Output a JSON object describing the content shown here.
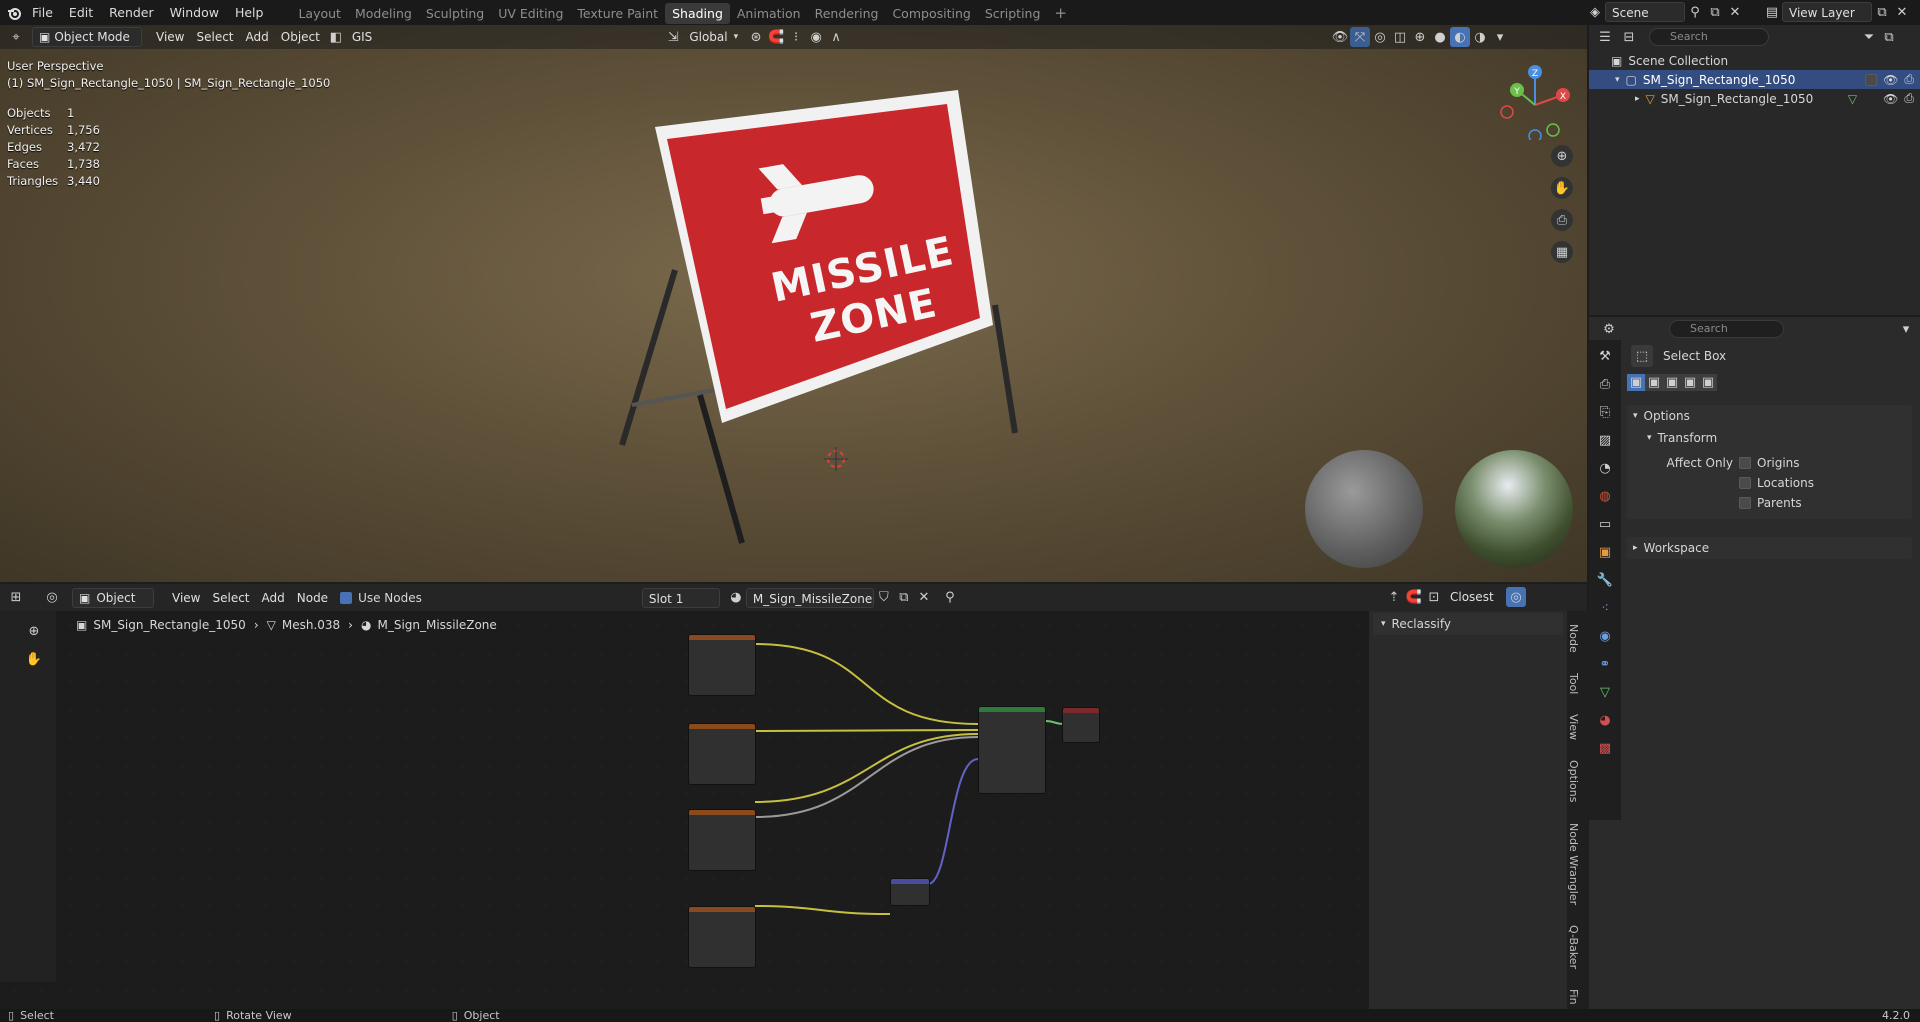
{
  "menu": [
    "File",
    "Edit",
    "Render",
    "Window",
    "Help"
  ],
  "workspaces": [
    "Layout",
    "Modeling",
    "Sculpting",
    "UV Editing",
    "Texture Paint",
    "Shading",
    "Animation",
    "Rendering",
    "Compositing",
    "Scripting"
  ],
  "active_workspace": "Shading",
  "scene_name": "Scene",
  "view_layer": "View Layer",
  "viewport": {
    "mode": "Object Mode",
    "menus": [
      "View",
      "Select",
      "Add",
      "Object"
    ],
    "gis": "GIS",
    "transform_orientation": "Global",
    "perspective": "User Perspective",
    "object_info": "(1) SM_Sign_Rectangle_1050 | SM_Sign_Rectangle_1050",
    "stats": [
      {
        "label": "Objects",
        "value": "1"
      },
      {
        "label": "Vertices",
        "value": "1,756"
      },
      {
        "label": "Edges",
        "value": "3,472"
      },
      {
        "label": "Faces",
        "value": "1,738"
      },
      {
        "label": "Triangles",
        "value": "3,440"
      }
    ],
    "sign_line1": "MISSILE",
    "sign_line2": "ZONE",
    "gizmo": {
      "x": "X",
      "y": "Y",
      "z": "Z"
    }
  },
  "outliner": {
    "search_placeholder": "Search",
    "collection": "Scene Collection",
    "items": [
      "SM_Sign_Rectangle_1050",
      "SM_Sign_Rectangle_1050"
    ]
  },
  "properties": {
    "search_placeholder": "Search",
    "tool": "Select Box",
    "options": "Options",
    "transform": "Transform",
    "affect_only": "Affect Only",
    "checks": [
      "Origins",
      "Locations",
      "Parents"
    ],
    "workspace": "Workspace"
  },
  "node_editor": {
    "editor_type": "Object",
    "menus": [
      "View",
      "Select",
      "Add",
      "Node"
    ],
    "use_nodes": "Use Nodes",
    "slot": "Slot 1",
    "material": "M_Sign_MissileZone",
    "snap": "Closest",
    "breadcrumb": [
      "SM_Sign_Rectangle_1050",
      "Mesh.038",
      "M_Sign_MissileZone"
    ],
    "panel_title": "Reclassify",
    "vtabs": [
      "Node",
      "Tool",
      "View",
      "Options",
      "Node Wrangler",
      "Q-Baker",
      "Fin"
    ]
  },
  "status": {
    "select": "Select",
    "rotate": "Rotate View",
    "object": "Object",
    "version": "4.2.0"
  },
  "colors": {
    "accent": "#4772b3",
    "sign_red": "#c8282b",
    "header": "#1a1a1a"
  }
}
